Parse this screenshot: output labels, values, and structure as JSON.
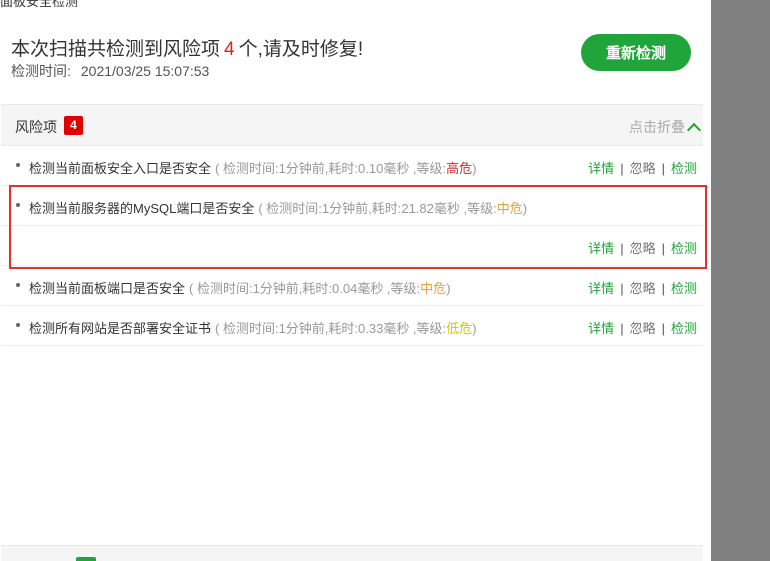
{
  "window": {
    "title": "面板安全检测"
  },
  "summary": {
    "prefix": "本次扫描共检测到风险项",
    "count": "4",
    "suffix": "个,请及时修复!",
    "time_label": "检测时间:",
    "time_value": "2021/03/25 15:07:53"
  },
  "rescan_button": "重新检测",
  "risk_section": {
    "title": "风险项",
    "badge": "4",
    "collapse_label": "点击折叠"
  },
  "risks": [
    {
      "title": "检测当前面板安全入口是否安全",
      "meta_prefix": "( 检测时间:1分钟前,耗时:0.10毫秒 ,等级:",
      "level": "高危",
      "meta_suffix": ")"
    },
    {
      "title": "检测当前服务器的MySQL端口是否安全",
      "meta_prefix": "( 检测时间:1分钟前,耗时:21.82毫秒 ,等级:",
      "level": "中危",
      "meta_suffix": ")"
    },
    {
      "title": "检测当前面板端口是否安全",
      "meta_prefix": "( 检测时间:1分钟前,耗时:0.04毫秒 ,等级:",
      "level": "中危",
      "meta_suffix": ")"
    },
    {
      "title": "检测所有网站是否部署安全证书",
      "meta_prefix": "( 检测时间:1分钟前,耗时:0.33毫秒 ,等级:",
      "level": "低危",
      "meta_suffix": ")"
    }
  ],
  "actions": {
    "details": "详情",
    "ignore": "忽略",
    "check": "检测",
    "separator": "|"
  },
  "colors": {
    "accent": "#20a53a",
    "danger": "#e00000",
    "high": "#c9302c",
    "medium": "#e6a23c",
    "low": "#e0c000",
    "highlight_border": "#e63030"
  }
}
